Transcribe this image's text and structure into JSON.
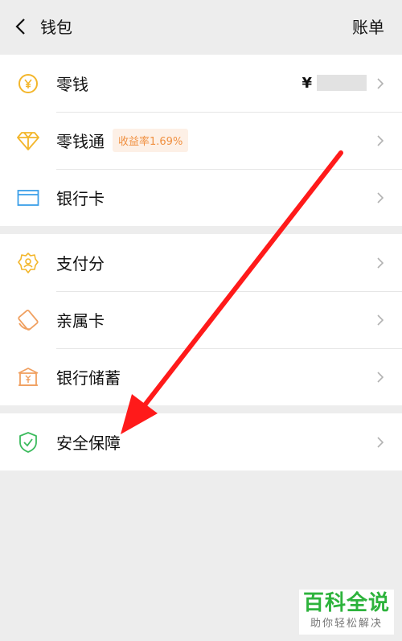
{
  "header": {
    "title": "钱包",
    "right_label": "账单"
  },
  "group1": [
    {
      "label": "零钱",
      "icon": "coin-icon",
      "balance_symbol": "¥"
    },
    {
      "label": "零钱通",
      "icon": "diamond-icon",
      "badge": "收益率1.69%"
    },
    {
      "label": "银行卡",
      "icon": "bank-card-icon"
    }
  ],
  "group2": [
    {
      "label": "支付分",
      "icon": "badge-shield-icon"
    },
    {
      "label": "亲属卡",
      "icon": "family-card-icon"
    },
    {
      "label": "银行储蓄",
      "icon": "bank-savings-icon"
    }
  ],
  "group3": [
    {
      "label": "安全保障",
      "icon": "security-shield-icon"
    }
  ],
  "watermark": {
    "main": "百科全说",
    "sub": "助你轻松解决"
  },
  "colors": {
    "arrow": "#ff1a1a",
    "badge_text": "#f09040",
    "watermark_green": "#2db33c"
  }
}
